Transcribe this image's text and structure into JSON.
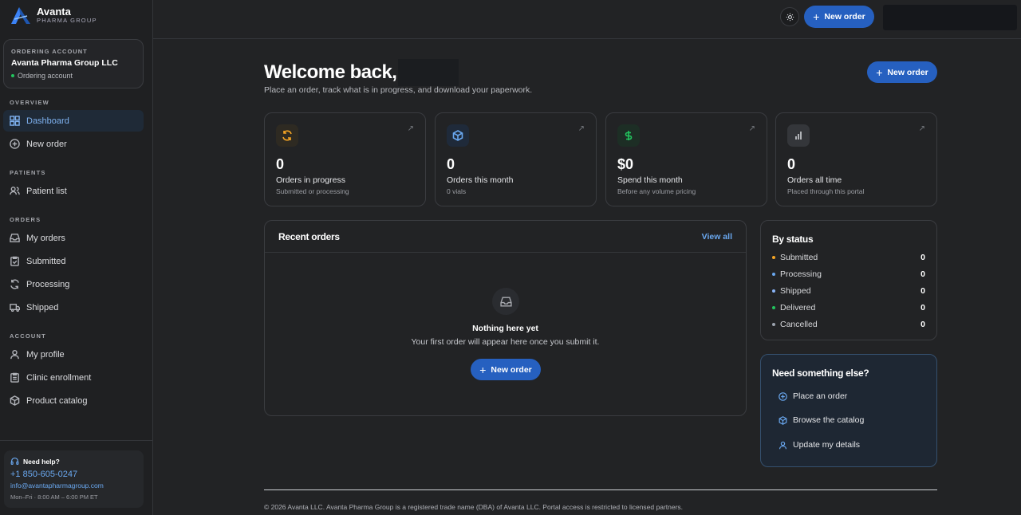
{
  "brand": {
    "name": "Avanta",
    "sub": "PHARMA GROUP"
  },
  "account": {
    "label": "ORDERING ACCOUNT",
    "name": "Avanta Pharma Group LLC",
    "status": "Ordering account"
  },
  "nav": {
    "overview_label": "OVERVIEW",
    "dashboard": "Dashboard",
    "new_order": "New order",
    "patients_label": "PATIENTS",
    "patient_list": "Patient list",
    "orders_label": "ORDERS",
    "my_orders": "My orders",
    "submitted": "Submitted",
    "processing": "Processing",
    "shipped": "Shipped",
    "account_label": "ACCOUNT",
    "my_profile": "My profile",
    "clinic_enrollment": "Clinic enrollment",
    "product_catalog": "Product catalog"
  },
  "help": {
    "title": "Need help?",
    "phone": "+1 850-605-0247",
    "email": "info@avantapharmagroup.com",
    "hours": "Mon–Fri · 8:00 AM – 6:00 PM ET"
  },
  "topbar": {
    "new_order": "New order"
  },
  "main": {
    "welcome": "Welcome back,",
    "subtitle": "Place an order, track what is in progress, and download your paperwork.",
    "new_order": "New order"
  },
  "stats": [
    {
      "value": "0",
      "label": "Orders in progress",
      "sub": "Submitted or processing"
    },
    {
      "value": "0",
      "label": "Orders this month",
      "sub": "0 vials"
    },
    {
      "value": "$0",
      "label": "Spend this month",
      "sub": "Before any volume pricing"
    },
    {
      "value": "0",
      "label": "Orders all time",
      "sub": "Placed through this portal"
    }
  ],
  "recent": {
    "title": "Recent orders",
    "view_all": "View all",
    "empty_title": "Nothing here yet",
    "empty_sub": "Your first order will appear here once you submit it.",
    "new_order": "New order"
  },
  "by_status": {
    "title": "By status",
    "rows": [
      {
        "label": "Submitted",
        "count": "0",
        "color": "#f5a524"
      },
      {
        "label": "Processing",
        "count": "0",
        "color": "#6aa8f0"
      },
      {
        "label": "Shipped",
        "count": "0",
        "color": "#8ab4f8"
      },
      {
        "label": "Delivered",
        "count": "0",
        "color": "#22c55e"
      },
      {
        "label": "Cancelled",
        "count": "0",
        "color": "#9ca3af"
      }
    ]
  },
  "need_else": {
    "title": "Need something else?",
    "links": [
      "Place an order",
      "Browse the catalog",
      "Update my details"
    ]
  },
  "footer": "© 2026 Avanta LLC. Avanta Pharma Group is a registered trade name (DBA) of Avanta LLC. Portal access is restricted to licensed partners."
}
